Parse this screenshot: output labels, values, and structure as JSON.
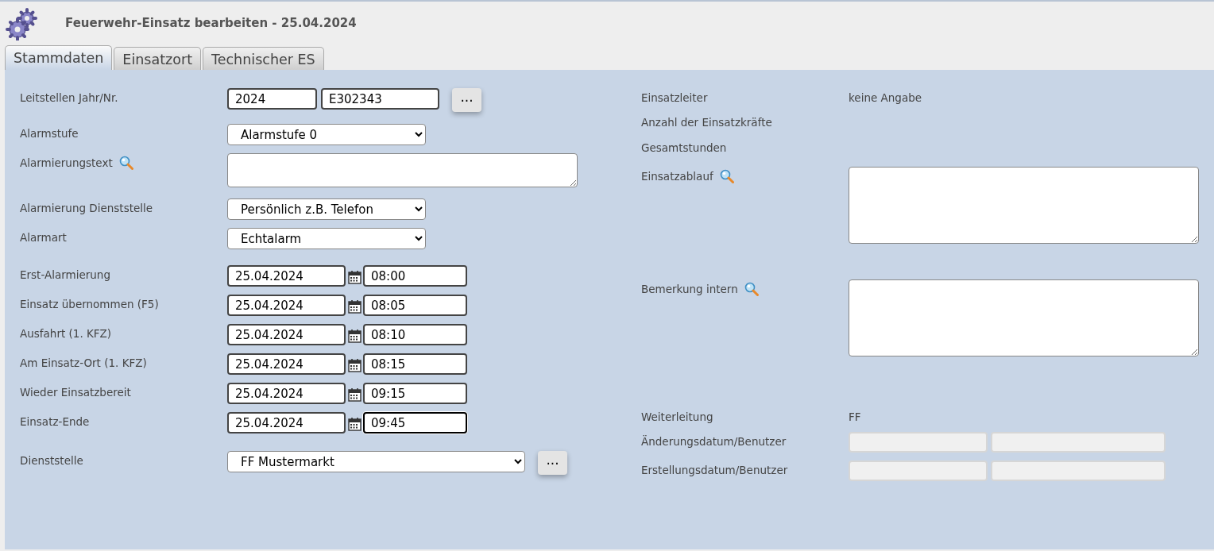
{
  "window": {
    "title": "Feuerwehr-Einsatz bearbeiten - 25.04.2024"
  },
  "tabs": [
    {
      "label": "Stammdaten",
      "selected": true
    },
    {
      "label": "Einsatzort",
      "selected": false
    },
    {
      "label": "Technischer ES",
      "selected": false
    }
  ],
  "left_groups": [
    [
      {
        "kind": "pair",
        "label": "Leitstellen Jahr/Nr.",
        "values": [
          "2024",
          "E302343"
        ],
        "button": "..."
      },
      {
        "kind": "select",
        "label": "Alarmstufe",
        "value": "Alarmstufe 0"
      },
      {
        "kind": "textarea",
        "label": "Alarmierungstext",
        "search": true
      }
    ],
    [
      {
        "kind": "select",
        "label": "Alarmierung Dienststelle",
        "value": "Persönlich z.B. Telefon"
      },
      {
        "kind": "select",
        "label": "Alarmart",
        "value": "Echtalarm"
      }
    ],
    [
      {
        "kind": "datetime",
        "label": "Erst-Alarmierung",
        "date": "25.04.2024",
        "time": "08:00",
        "focused": false
      },
      {
        "kind": "datetime",
        "label": "Einsatz übernommen (F5)",
        "date": "25.04.2024",
        "time": "08:05",
        "focused": false
      },
      {
        "kind": "datetime",
        "label": "Ausfahrt (1. KFZ)",
        "date": "25.04.2024",
        "time": "08:10",
        "focused": false
      },
      {
        "kind": "datetime",
        "label": "Am Einsatz-Ort (1. KFZ)",
        "date": "25.04.2024",
        "time": "08:15",
        "focused": false
      },
      {
        "kind": "datetime",
        "label": "Wieder Einsatzbereit",
        "date": "25.04.2024",
        "time": "09:15",
        "focused": false
      },
      {
        "kind": "datetime",
        "label": "Einsatz-Ende",
        "date": "25.04.2024",
        "time": "09:45",
        "focused": true
      }
    ],
    [
      {
        "kind": "select_button",
        "label": "Dienststelle",
        "value": "FF Mustermarkt",
        "button": "..."
      }
    ]
  ],
  "right_groups": [
    [
      {
        "kind": "text",
        "label": "Einsatzleiter",
        "value": "keine Angabe"
      },
      {
        "kind": "text",
        "label": "Anzahl der Einsatzkräfte"
      },
      {
        "kind": "text",
        "label": "Gesamtstunden"
      }
    ],
    [
      {
        "kind": "textarea",
        "label": "Einsatzablauf",
        "search": true
      },
      {
        "kind": "textarea",
        "label": "Bemerkung intern",
        "search": true
      }
    ],
    [
      {
        "kind": "text",
        "label": "Weiterleitung",
        "value": "FF"
      },
      {
        "kind": "readonly_pair",
        "label": "Änderungsdatum/Benutzer"
      },
      {
        "kind": "readonly_pair",
        "label": "Erstellungsdatum/Benutzer"
      }
    ]
  ]
}
